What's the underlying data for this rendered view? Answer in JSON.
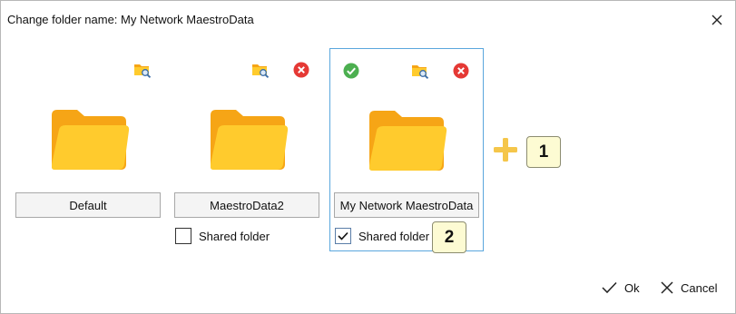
{
  "dialog": {
    "title": "Change folder name: My Network MaestroData",
    "close_icon": "close-icon"
  },
  "folders": [
    {
      "name": "Default",
      "shared_visible": false,
      "selected": false,
      "icons": [
        "browse-folder-icon"
      ]
    },
    {
      "name": "MaestroData2",
      "shared_label": "Shared folder",
      "shared_checked": false,
      "selected": false,
      "icons": [
        "browse-folder-icon",
        "remove-icon"
      ]
    },
    {
      "name": "My Network MaestroData",
      "shared_label": "Shared folder",
      "shared_checked": true,
      "selected": true,
      "icons": [
        "active-check-icon",
        "browse-folder-icon",
        "remove-icon"
      ]
    }
  ],
  "add_button": {
    "icon": "plus-icon"
  },
  "callouts": [
    "1",
    "2"
  ],
  "footer": {
    "ok_label": "Ok",
    "cancel_label": "Cancel"
  },
  "colors": {
    "folder_back": "#F6A516",
    "folder_front": "#FFCB2D",
    "selection_border": "#5AA7DD",
    "check_green": "#4CAF50",
    "remove_red": "#E53935",
    "plus": "#F5C64A",
    "callout_bg": "#FDFBD3"
  }
}
